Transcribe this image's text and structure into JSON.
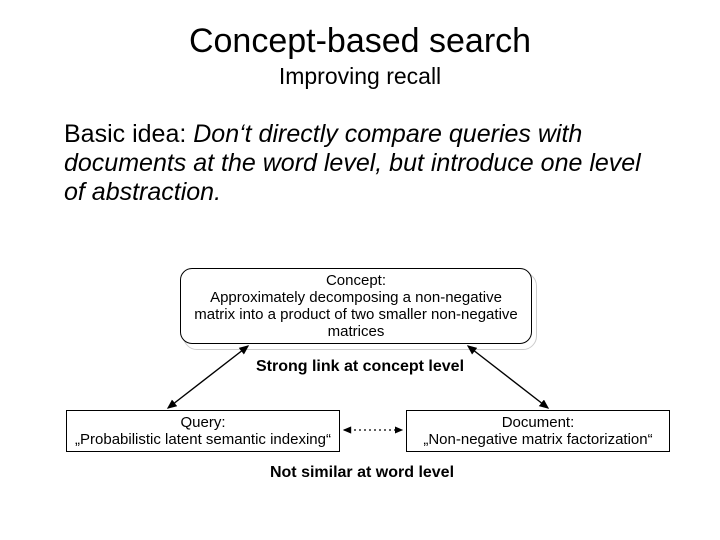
{
  "title": "Concept-based search",
  "subtitle": "Improving recall",
  "body": {
    "lead": "Basic idea: ",
    "idea": "Don‘t directly compare queries with documents at the word level, but introduce one level of abstraction."
  },
  "diagram": {
    "concept": {
      "title": "Concept:",
      "text": "Approximately decomposing a non-negative matrix into a product of two smaller non-negative matrices"
    },
    "link_caption": "Strong link at concept level",
    "query": {
      "title": "Query:",
      "text": "„Probabilistic latent semantic indexing“"
    },
    "document": {
      "title": "Document:",
      "text": "„Non-negative matrix factorization“"
    },
    "bottom_caption": "Not similar at word level"
  }
}
